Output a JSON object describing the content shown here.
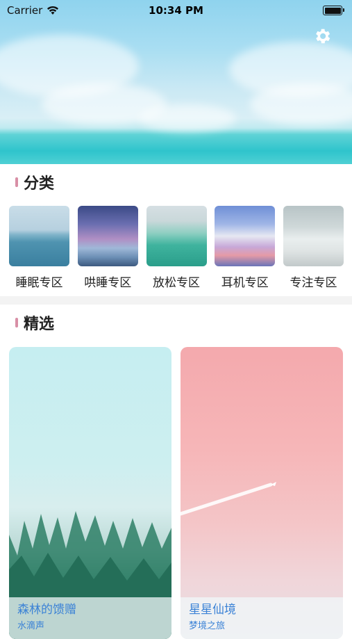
{
  "status": {
    "carrier": "Carrier",
    "time": "10:34 PM"
  },
  "sections": {
    "category_title": "分类",
    "featured_title": "精选"
  },
  "categories": [
    {
      "label": "睡眠专区"
    },
    {
      "label": "哄睡专区"
    },
    {
      "label": "放松专区"
    },
    {
      "label": "耳机专区"
    },
    {
      "label": "专注专区"
    }
  ],
  "featured": [
    {
      "title": "森林的馈赠",
      "subtitle": "水滴声"
    },
    {
      "title": "星星仙境",
      "subtitle": "梦境之旅"
    }
  ],
  "colors": {
    "accent_bar": "#d88fa6",
    "card_text": "#3b82d6"
  },
  "icons": {
    "settings": "gear-icon",
    "wifi": "wifi-icon",
    "battery": "battery-icon"
  }
}
